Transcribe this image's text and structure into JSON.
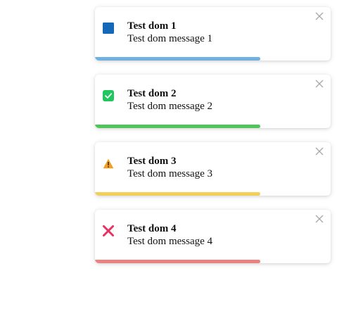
{
  "toasts": [
    {
      "title": "Test dom 1",
      "message": "Test dom message 1",
      "type": "info",
      "icon": "info-square-icon",
      "icon_color": "#1568b8",
      "progress_color": "#6fb1e0",
      "progress": 0.7
    },
    {
      "title": "Test dom 2",
      "message": "Test dom message 2",
      "type": "success",
      "icon": "check-square-icon",
      "icon_color": "#22c55e",
      "progress_color": "#4fc65a",
      "progress": 0.7
    },
    {
      "title": "Test dom 3",
      "message": "Test dom message 3",
      "type": "warning",
      "icon": "warning-triangle-icon",
      "icon_color": "#f0a020",
      "progress_color": "#f2cf5b",
      "progress": 0.7
    },
    {
      "title": "Test dom 4",
      "message": "Test dom message 4",
      "type": "error",
      "icon": "error-x-icon",
      "icon_color": "#e8315e",
      "progress_color": "#ea837f",
      "progress": 0.7
    }
  ]
}
